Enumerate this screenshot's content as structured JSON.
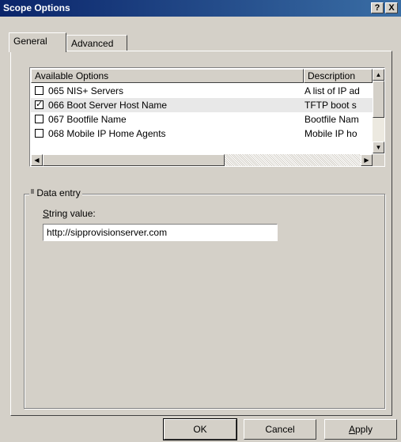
{
  "window": {
    "title": "Scope Options",
    "help_glyph": "?",
    "close_glyph": "X"
  },
  "tabs": [
    {
      "label": "General",
      "active": true
    },
    {
      "label": "Advanced",
      "active": false
    }
  ],
  "list": {
    "columns": [
      "Available Options",
      "Description"
    ],
    "rows": [
      {
        "checked": false,
        "name": "065 NIS+ Servers",
        "description": "A list of IP ad"
      },
      {
        "checked": true,
        "name": "066 Boot Server Host Name",
        "description": "TFTP boot s"
      },
      {
        "checked": false,
        "name": "067 Bootfile Name",
        "description": "Bootfile Nam"
      },
      {
        "checked": false,
        "name": "068 Mobile IP Home Agents",
        "description": "Mobile IP ho"
      }
    ],
    "checkmark": "✓"
  },
  "data_entry": {
    "group_label": "Data entry",
    "string_label_accel": "S",
    "string_label_rest": "tring value:",
    "string_value": "http://sipprovisionserver.com"
  },
  "buttons": {
    "ok": "OK",
    "cancel": "Cancel",
    "apply_accel": "A",
    "apply_rest": "pply"
  }
}
